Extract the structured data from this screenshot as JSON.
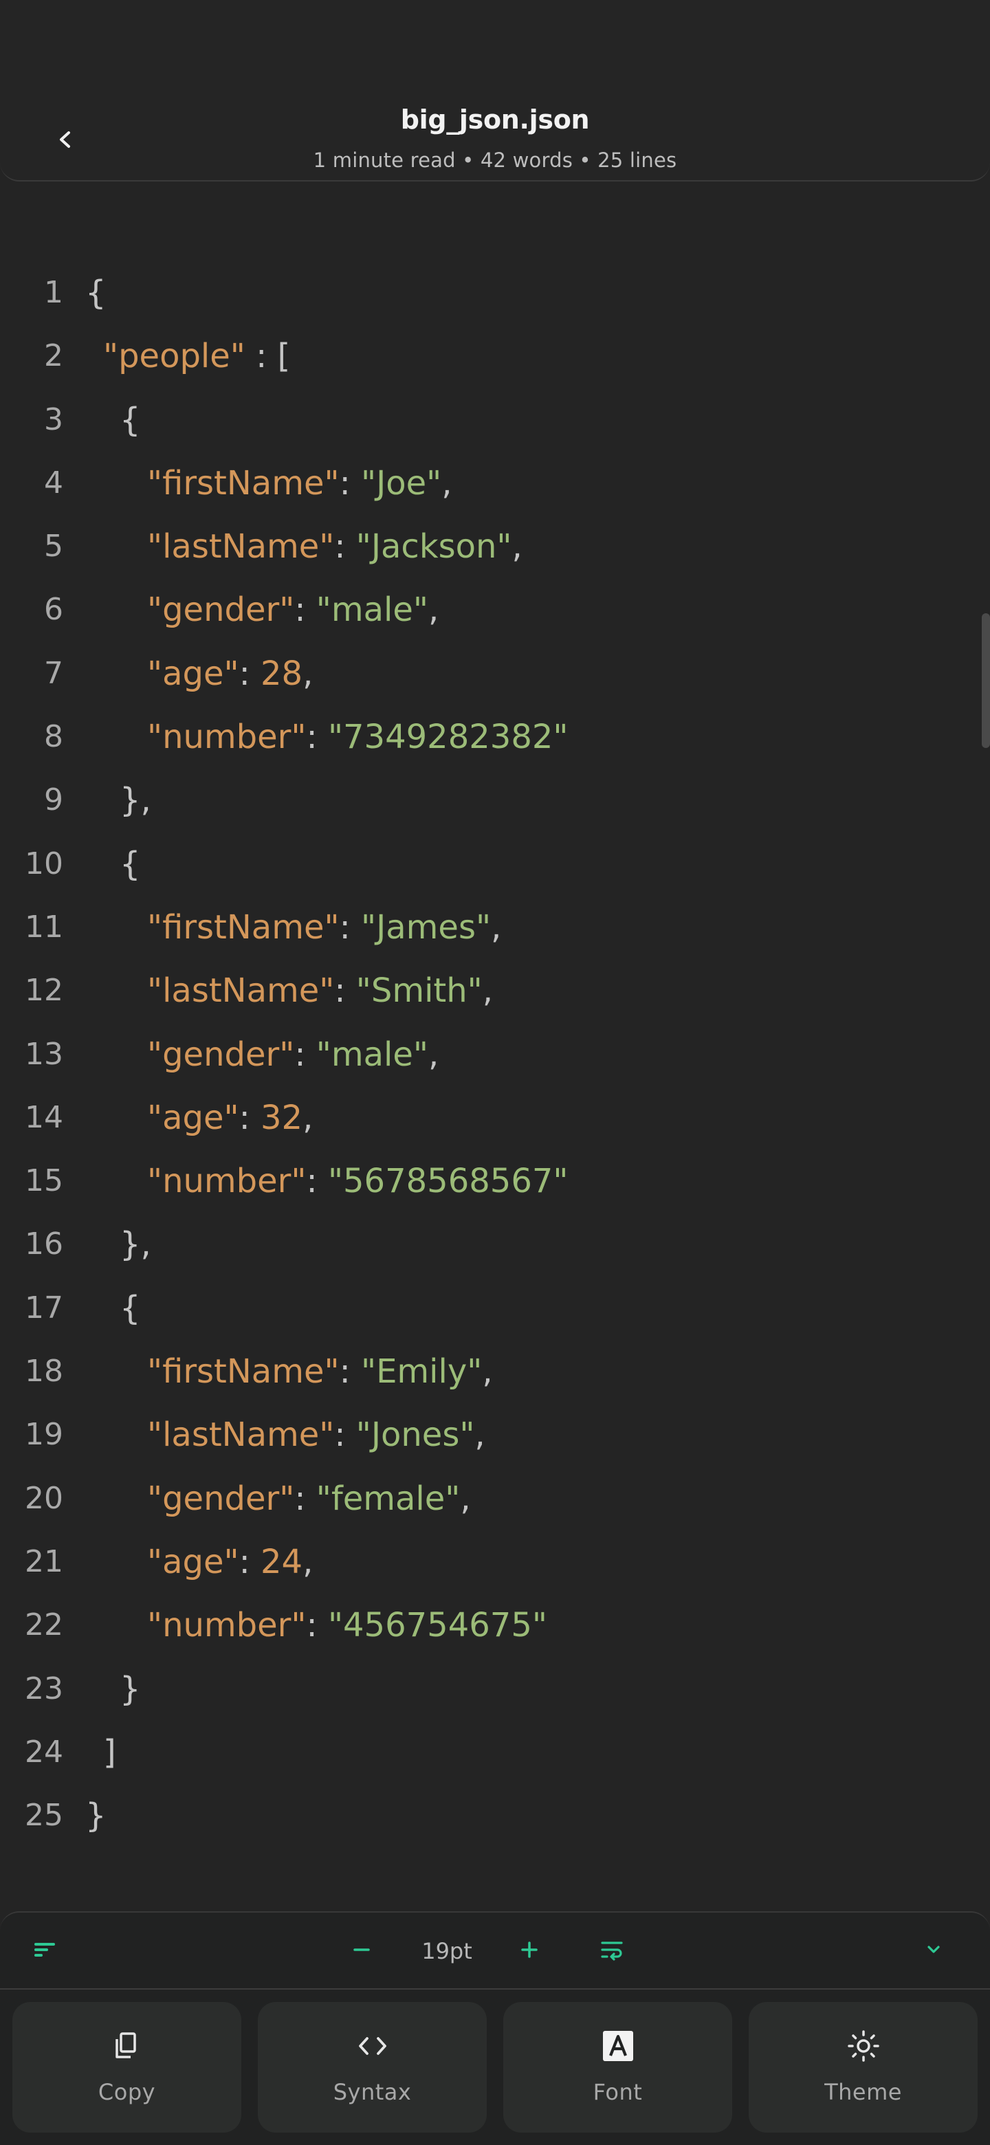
{
  "header": {
    "title": "big_json.json",
    "subtitle": "1 minute read • 42 words • 25 lines"
  },
  "code_lines": [
    {
      "num": "1",
      "indent": 0,
      "tokens": [
        [
          "p",
          "{"
        ]
      ]
    },
    {
      "num": "2",
      "indent": 1,
      "tokens": [
        [
          "k",
          "\"people\""
        ],
        [
          "p",
          " : ["
        ]
      ]
    },
    {
      "num": "3",
      "indent": 2,
      "tokens": [
        [
          "p",
          "{"
        ]
      ]
    },
    {
      "num": "4",
      "indent": 3,
      "tokens": [
        [
          "k",
          "\"firstName\""
        ],
        [
          "p",
          ": "
        ],
        [
          "s",
          "\"Joe\""
        ],
        [
          "p",
          ","
        ]
      ]
    },
    {
      "num": "5",
      "indent": 3,
      "tokens": [
        [
          "k",
          "\"lastName\""
        ],
        [
          "p",
          ": "
        ],
        [
          "s",
          "\"Jackson\""
        ],
        [
          "p",
          ","
        ]
      ]
    },
    {
      "num": "6",
      "indent": 3,
      "tokens": [
        [
          "k",
          "\"gender\""
        ],
        [
          "p",
          ": "
        ],
        [
          "s",
          "\"male\""
        ],
        [
          "p",
          ","
        ]
      ]
    },
    {
      "num": "7",
      "indent": 3,
      "tokens": [
        [
          "k",
          "\"age\""
        ],
        [
          "p",
          ": "
        ],
        [
          "n",
          "28"
        ],
        [
          "p",
          ","
        ]
      ]
    },
    {
      "num": "8",
      "indent": 3,
      "tokens": [
        [
          "k",
          "\"number\""
        ],
        [
          "p",
          ": "
        ],
        [
          "s",
          "\"7349282382\""
        ]
      ]
    },
    {
      "num": "9",
      "indent": 2,
      "tokens": [
        [
          "p",
          "},"
        ]
      ]
    },
    {
      "num": "10",
      "indent": 2,
      "tokens": [
        [
          "p",
          "{"
        ]
      ]
    },
    {
      "num": "11",
      "indent": 3,
      "tokens": [
        [
          "k",
          "\"firstName\""
        ],
        [
          "p",
          ": "
        ],
        [
          "s",
          "\"James\""
        ],
        [
          "p",
          ","
        ]
      ]
    },
    {
      "num": "12",
      "indent": 3,
      "tokens": [
        [
          "k",
          "\"lastName\""
        ],
        [
          "p",
          ": "
        ],
        [
          "s",
          "\"Smith\""
        ],
        [
          "p",
          ","
        ]
      ]
    },
    {
      "num": "13",
      "indent": 3,
      "tokens": [
        [
          "k",
          "\"gender\""
        ],
        [
          "p",
          ": "
        ],
        [
          "s",
          "\"male\""
        ],
        [
          "p",
          ","
        ]
      ]
    },
    {
      "num": "14",
      "indent": 3,
      "tokens": [
        [
          "k",
          "\"age\""
        ],
        [
          "p",
          ": "
        ],
        [
          "n",
          "32"
        ],
        [
          "p",
          ","
        ]
      ]
    },
    {
      "num": "15",
      "indent": 3,
      "tokens": [
        [
          "k",
          "\"number\""
        ],
        [
          "p",
          ": "
        ],
        [
          "s",
          "\"5678568567\""
        ]
      ]
    },
    {
      "num": "16",
      "indent": 2,
      "tokens": [
        [
          "p",
          "},"
        ]
      ]
    },
    {
      "num": "17",
      "indent": 2,
      "tokens": [
        [
          "p",
          "{"
        ]
      ]
    },
    {
      "num": "18",
      "indent": 3,
      "tokens": [
        [
          "k",
          "\"firstName\""
        ],
        [
          "p",
          ": "
        ],
        [
          "s",
          "\"Emily\""
        ],
        [
          "p",
          ","
        ]
      ]
    },
    {
      "num": "19",
      "indent": 3,
      "tokens": [
        [
          "k",
          "\"lastName\""
        ],
        [
          "p",
          ": "
        ],
        [
          "s",
          "\"Jones\""
        ],
        [
          "p",
          ","
        ]
      ]
    },
    {
      "num": "20",
      "indent": 3,
      "tokens": [
        [
          "k",
          "\"gender\""
        ],
        [
          "p",
          ": "
        ],
        [
          "s",
          "\"female\""
        ],
        [
          "p",
          ","
        ]
      ]
    },
    {
      "num": "21",
      "indent": 3,
      "tokens": [
        [
          "k",
          "\"age\""
        ],
        [
          "p",
          ": "
        ],
        [
          "n",
          "24"
        ],
        [
          "p",
          ","
        ]
      ]
    },
    {
      "num": "22",
      "indent": 3,
      "tokens": [
        [
          "k",
          "\"number\""
        ],
        [
          "p",
          ": "
        ],
        [
          "s",
          "\"456754675\""
        ]
      ]
    },
    {
      "num": "23",
      "indent": 2,
      "tokens": [
        [
          "p",
          "}"
        ]
      ]
    },
    {
      "num": "24",
      "indent": 1,
      "tokens": [
        [
          "p",
          "]"
        ]
      ]
    },
    {
      "num": "25",
      "indent": 0,
      "tokens": [
        [
          "p",
          "}"
        ]
      ]
    }
  ],
  "toolbar": {
    "font_size": "19pt",
    "icons": [
      "outline-icon",
      "minus-icon",
      "plus-icon",
      "wrap-icon",
      "chevron-down-icon"
    ]
  },
  "actions": [
    {
      "label": "Copy",
      "icon": "copy-icon"
    },
    {
      "label": "Syntax",
      "icon": "code-icon"
    },
    {
      "label": "Font",
      "icon": "font-icon"
    },
    {
      "label": "Theme",
      "icon": "sun-icon"
    }
  ],
  "colors": {
    "background": "#242424",
    "accent": "#2ec994",
    "key": "#d4975a",
    "string": "#9cbc78",
    "punctuation": "#c4c4c4"
  }
}
